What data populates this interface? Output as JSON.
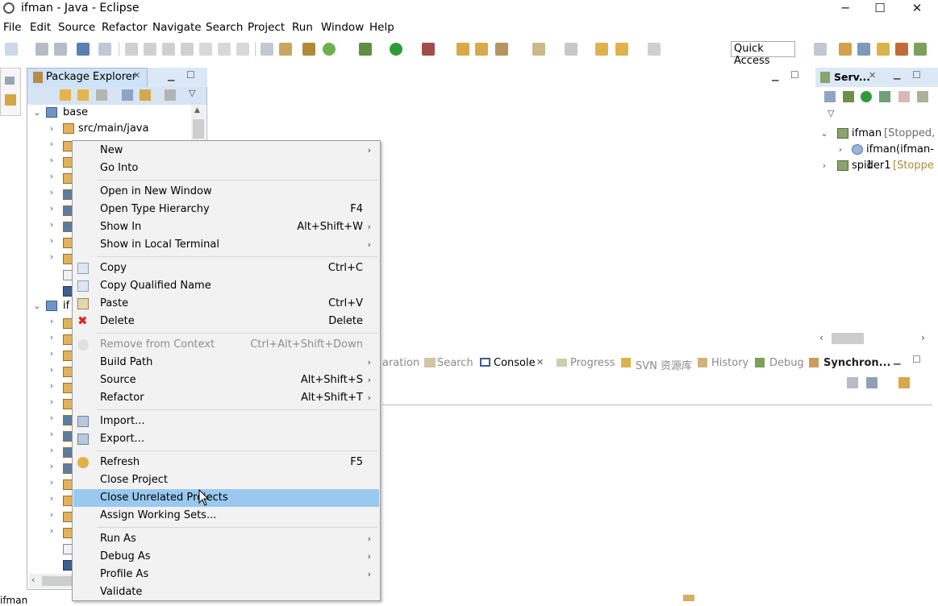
{
  "window": {
    "title": "ifman - Java - Eclipse",
    "min": "─",
    "max": "☐",
    "close": "✕"
  },
  "menubar": [
    "File",
    "Edit",
    "Source",
    "Refactor",
    "Navigate",
    "Search",
    "Project",
    "Run",
    "Window",
    "Help"
  ],
  "toolbar": {
    "quick_access": "Quick Access"
  },
  "package_explorer": {
    "tab_label": "Package Explorer",
    "tree": [
      {
        "label": "base"
      },
      {
        "label": "src/main/java"
      },
      {
        "label": "if"
      }
    ]
  },
  "servers": {
    "tab_label": "Serv...",
    "items": [
      {
        "label": "ifman",
        "status": "[Stopped,"
      },
      {
        "label": "ifman(ifman-1"
      },
      {
        "label": "spider1",
        "status": "[Stoppe"
      }
    ]
  },
  "bottom_tabs": [
    "aration",
    "Search",
    "Console",
    "Progress",
    "SVN 资源库",
    "History",
    "Debug",
    "Synchron..."
  ],
  "context_menu": {
    "items": [
      {
        "label": "New",
        "submenu": "›"
      },
      {
        "label": "Go Into"
      },
      {
        "label": "Open in New Window"
      },
      {
        "label": "Open Type Hierarchy",
        "shortcut": "F4"
      },
      {
        "label": "Show In",
        "shortcut": "Alt+Shift+W",
        "submenu": "›"
      },
      {
        "label": "Show in Local Terminal",
        "submenu": "›"
      },
      {
        "label": "Copy",
        "shortcut": "Ctrl+C"
      },
      {
        "label": "Copy Qualified Name"
      },
      {
        "label": "Paste",
        "shortcut": "Ctrl+V"
      },
      {
        "label": "Delete",
        "shortcut": "Delete"
      },
      {
        "label": "Remove from Context",
        "shortcut": "Ctrl+Alt+Shift+Down"
      },
      {
        "label": "Build Path",
        "submenu": "›"
      },
      {
        "label": "Source",
        "shortcut": "Alt+Shift+S",
        "submenu": "›"
      },
      {
        "label": "Refactor",
        "shortcut": "Alt+Shift+T",
        "submenu": "›"
      },
      {
        "label": "Import..."
      },
      {
        "label": "Export..."
      },
      {
        "label": "Refresh",
        "shortcut": "F5"
      },
      {
        "label": "Close Project"
      },
      {
        "label": "Close Unrelated Projects"
      },
      {
        "label": "Assign Working Sets..."
      },
      {
        "label": "Run As",
        "submenu": "›"
      },
      {
        "label": "Debug As",
        "submenu": "›"
      },
      {
        "label": "Profile As",
        "submenu": "›"
      },
      {
        "label": "Validate"
      }
    ]
  },
  "status_bar": {
    "text": "ifman"
  },
  "colors": {
    "selection": "#99c9ef",
    "view_tab": "#dbe8f6",
    "menu_bg": "#f2f2f2"
  }
}
